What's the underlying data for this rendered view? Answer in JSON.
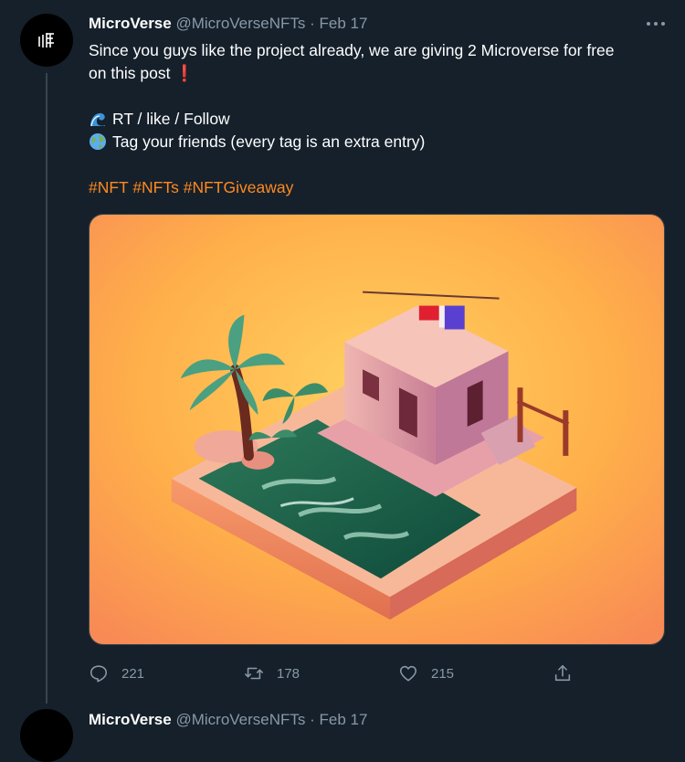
{
  "tweet": {
    "author_name": "MicroVerse",
    "handle_date": "@MicroVerseNFTs · Feb 17",
    "more_icon": "more-horizontal-icon",
    "text_line1": "Since you guys like the project already, we are giving 2 Microverse for free",
    "text_line2": "on this post",
    "line2_emoji": "❗",
    "list_item1_emoji": "wave-emoji",
    "list_item1": "RT / like / Follow",
    "list_item2_emoji": "globe-emoji",
    "list_item2": "Tag your friends (every tag is an extra entry)",
    "hashtags": [
      "#NFT",
      "#NFTs",
      "#NFTGiveaway"
    ],
    "media_alt": "isometric island with a house and palm trees",
    "stats": {
      "replies": "221",
      "retweets": "178",
      "likes": "215"
    },
    "colors": {
      "background": "#15202b",
      "hashtag": "#ff8a1f",
      "muted": "#8899a6"
    }
  },
  "next_tweet": {
    "author_name": "MicroVerse",
    "handle_date": "@MicroVerseNFTs · Feb 17"
  }
}
